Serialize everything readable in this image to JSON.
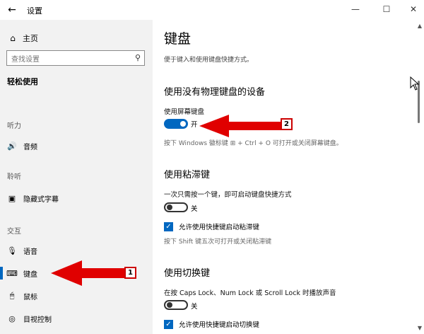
{
  "window": {
    "title": "设置",
    "back_glyph": "←",
    "minimize_glyph": "—",
    "maximize_glyph": "☐",
    "close_glyph": "✕"
  },
  "sidebar": {
    "home": {
      "label": "主页",
      "icon": "home-icon",
      "glyph": "⌂"
    },
    "search": {
      "placeholder": "查找设置",
      "icon": "search-icon",
      "glyph": "⚲"
    },
    "category": "轻松使用",
    "groups": [
      {
        "label": "听力",
        "items": [
          {
            "label": "音频",
            "icon": "speaker-icon",
            "glyph": "🔊"
          }
        ]
      },
      {
        "label": "聆听",
        "items": [
          {
            "label": "隐藏式字幕",
            "icon": "captions-icon",
            "glyph": "▣"
          }
        ]
      },
      {
        "label": "交互",
        "items": [
          {
            "label": "语音",
            "icon": "microphone-icon",
            "glyph": "🎙"
          },
          {
            "label": "键盘",
            "icon": "keyboard-icon",
            "glyph": "⌨",
            "selected": true
          },
          {
            "label": "鼠标",
            "icon": "mouse-icon",
            "glyph": "🖱"
          },
          {
            "label": "目视控制",
            "icon": "eye-control-icon",
            "glyph": "◎"
          }
        ]
      }
    ]
  },
  "main": {
    "title": "键盘",
    "subtitle": "便于键入和使用键盘快捷方式。",
    "sections": [
      {
        "heading": "使用没有物理键盘的设备",
        "toggle_label": "使用屏幕键盘",
        "toggle_state": "开",
        "toggle_on": true,
        "hint": "按下 Windows 徽标键 ⊞ + Ctrl + O 可打开或关闭屏幕键盘。"
      },
      {
        "heading": "使用粘滞键",
        "toggle_label": "一次只需按一个键，即可启动键盘快捷方式",
        "toggle_state": "关",
        "toggle_on": false,
        "checkbox_label": "允许使用快捷键启动粘滞键",
        "checkbox_checked": true,
        "hint": "按下 Shift 键五次可打开或关闭粘滞键"
      },
      {
        "heading": "使用切换键",
        "toggle_label": "在按 Caps Lock、Num Lock 或 Scroll Lock 时播放声音",
        "toggle_state": "关",
        "toggle_on": false,
        "checkbox_label": "允许使用快捷键启动切换键",
        "checkbox_checked": true
      }
    ]
  },
  "annotations": [
    {
      "number": "1",
      "target": "键盘",
      "color": "#e00000"
    },
    {
      "number": "2",
      "target": "使用屏幕键盘",
      "color": "#e00000"
    }
  ],
  "colors": {
    "accent": "#0067c0",
    "sidebar_bg": "#f2f2f2",
    "annotation": "#e00000"
  }
}
